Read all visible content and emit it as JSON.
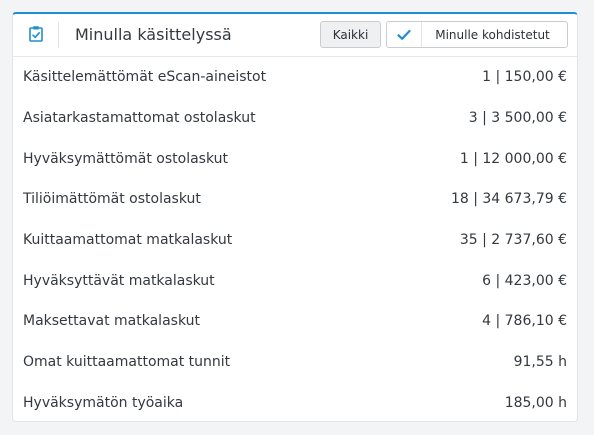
{
  "widget": {
    "title": "Minulla käsittelyssä",
    "header_icon": "clipboard-check-icon",
    "buttons": {
      "all_label": "Kaikki",
      "assigned_label": "Minulle kohdistetut",
      "assigned_checked": true
    }
  },
  "rows": [
    {
      "label": "Käsittelemättömät eScan-aineistot",
      "value": "1 | 150,00 €"
    },
    {
      "label": "Asiatarkastamattomat ostolaskut",
      "value": "3 | 3 500,00 €"
    },
    {
      "label": "Hyväksymättömät ostolaskut",
      "value": "1 | 12 000,00 €"
    },
    {
      "label": "Tiliöimättömät ostolaskut",
      "value": "18 | 34 673,79 €"
    },
    {
      "label": "Kuittaamattomat matkalaskut",
      "value": "35 | 2 737,60 €"
    },
    {
      "label": "Hyväksyttävät matkalaskut",
      "value": "6 | 423,00 €"
    },
    {
      "label": "Maksettavat matkalaskut",
      "value": "4 | 786,10 €"
    },
    {
      "label": "Omat kuittaamattomat tunnit",
      "value": "91,55 h"
    },
    {
      "label": "Hyväksymätön työaika",
      "value": "185,00 h"
    }
  ],
  "colors": {
    "accent": "#1f8ed4",
    "text": "#33393f"
  }
}
